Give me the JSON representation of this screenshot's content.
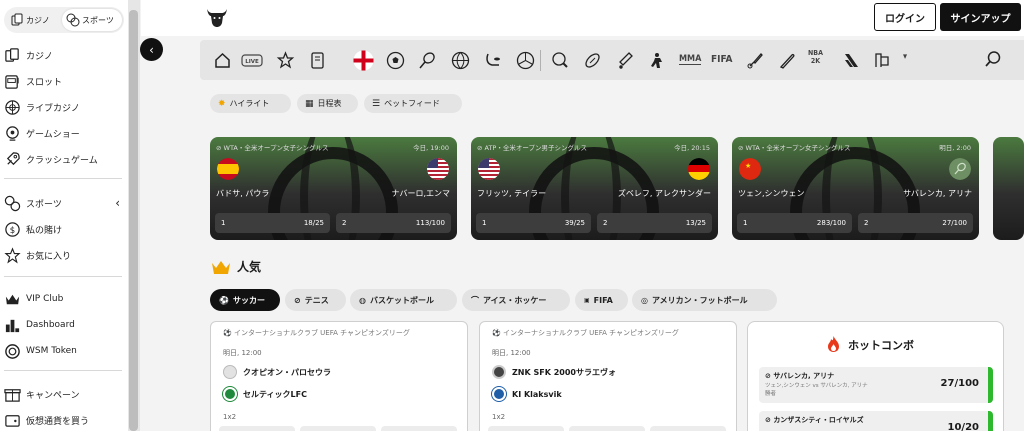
{
  "sidebar": {
    "toggle": {
      "casino": "カジノ",
      "sports": "スポーツ"
    },
    "items": [
      {
        "label": "カジノ",
        "icon": "cards-icon"
      },
      {
        "label": "スロット",
        "icon": "slot-machine-icon"
      },
      {
        "label": "ライブカジノ",
        "icon": "roulette-icon"
      },
      {
        "label": "ゲームショー",
        "icon": "game-show-icon"
      },
      {
        "label": "クラッシュゲーム",
        "icon": "rocket-icon"
      },
      {
        "label": "スポーツ",
        "icon": "balls-icon"
      },
      {
        "label": "私の賭け",
        "icon": "coin-icon"
      },
      {
        "label": "お気に入り",
        "icon": "star-icon"
      },
      {
        "label": "VIP Club",
        "icon": "crown-icon"
      },
      {
        "label": "Dashboard",
        "icon": "bar-chart-icon"
      },
      {
        "label": "WSM Token",
        "icon": "token-icon"
      },
      {
        "label": "キャンペーン",
        "icon": "gift-icon"
      },
      {
        "label": "仮想通貨を買う",
        "icon": "wallet-icon"
      }
    ]
  },
  "header": {
    "login": "ログイン",
    "signup": "サインアップ"
  },
  "sportnav": {
    "live": "LIVE",
    "mma": "MMA",
    "fifa": "FIFA",
    "nba": "NBA",
    "nba2k": "2K"
  },
  "filters": [
    "ハイライト",
    "日程表",
    "ベットフィード"
  ],
  "matches": [
    {
      "league": "WTA・全米オープン女子シングルス",
      "time": "今日, 19:00",
      "p1": "バドサ, パウラ",
      "p2": "ナバーロ,エンマ",
      "o1_label": "1",
      "o1": "18/25",
      "o2_label": "2",
      "o2": "113/100"
    },
    {
      "league": "ATP・全米オープン男子シングルス",
      "time": "今日, 20:15",
      "p1": "フリッツ, テイラー",
      "p2": "ズベレフ, アレクサンダー",
      "o1_label": "1",
      "o1": "39/25",
      "o2_label": "2",
      "o2": "13/25"
    },
    {
      "league": "WTA・全米オープン女子シングルス",
      "time": "明日, 2:00",
      "p1": "ツェン,シンウェン",
      "p2": "サバレンカ, アリナ",
      "o1_label": "1",
      "o1": "283/100",
      "o2_label": "2",
      "o2": "27/100"
    }
  ],
  "popular": {
    "title": "人気",
    "categories": [
      "サッカー",
      "テニス",
      "バスケットボール",
      "アイス・ホッケー",
      "FIFA",
      "アメリカン・フットボール"
    ]
  },
  "events": [
    {
      "league": "インターナショナルクラブ UEFA チャンピオンズリーグ",
      "date": "明日, 12:00",
      "home": "クオピオン・パロセウラ",
      "away": "セルティックLFC",
      "market": "1x2"
    },
    {
      "league": "インターナショナルクラブ UEFA チャンピオンズリーグ",
      "date": "明日, 12:00",
      "home": "ZNK SFK 2000サラエヴォ",
      "away": "KI Klaksvik",
      "market": "1x2"
    }
  ],
  "hot_combo": {
    "title": "ホットコンボ",
    "items": [
      {
        "name": "サバレンカ, アリナ",
        "sub": "ツェン,シンウェン vs サバレンカ, アリナ\n勝者",
        "odds": "27/100"
      },
      {
        "name": "カンザスシティ・ロイヤルズ",
        "sub": "",
        "odds": "10/20"
      }
    ]
  },
  "colors": {
    "accent": "#111111",
    "combo_bar": "#2eb82e",
    "crown": "#f0a500",
    "flame": "#e8391b"
  }
}
